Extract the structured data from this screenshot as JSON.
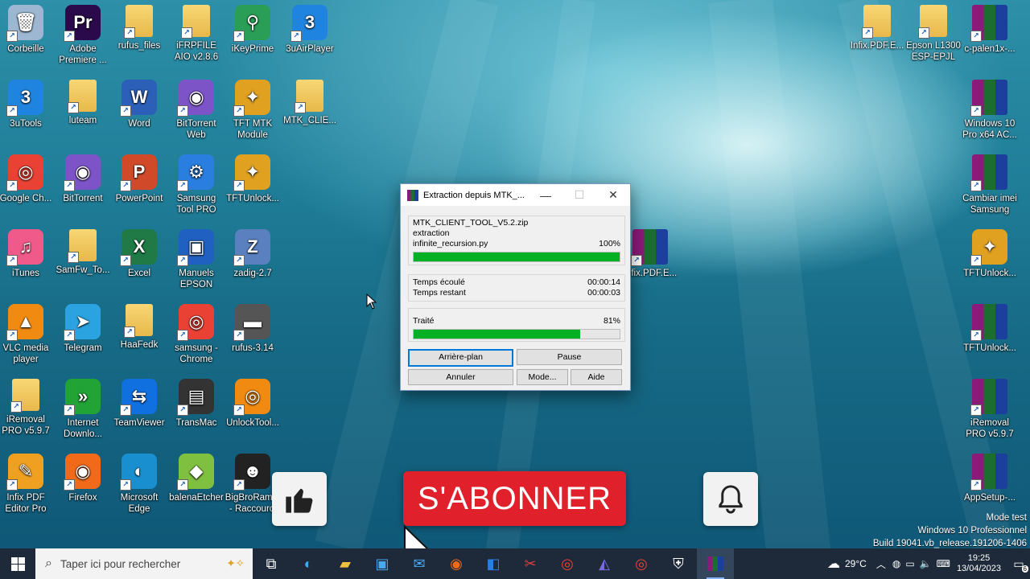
{
  "desktop": {
    "icons": [
      {
        "label": "Corbeille",
        "glyph": "🗑",
        "bg": "#9db7d2"
      },
      {
        "label": "Adobe Premiere ...",
        "glyph": "Pr",
        "bg": "#2a0a4a"
      },
      {
        "label": "rufus_files",
        "glyph": "",
        "bg": "folder"
      },
      {
        "label": "iFRPFILE AIO v2.8.6",
        "glyph": "",
        "bg": "folder"
      },
      {
        "label": "iKeyPrime",
        "glyph": "⚲",
        "bg": "#2a9d57"
      },
      {
        "label": "3uAirPlayer",
        "glyph": "3",
        "bg": "#1f84e0"
      },
      {
        "label": "3uTools",
        "glyph": "3",
        "bg": "#1f84e0"
      },
      {
        "label": "luteam",
        "glyph": "",
        "bg": "folder"
      },
      {
        "label": "Word",
        "glyph": "W",
        "bg": "#2b5fb8"
      },
      {
        "label": "BitTorrent Web",
        "glyph": "◉",
        "bg": "#7c54c8"
      },
      {
        "label": "TFT MTK Module",
        "glyph": "✦",
        "bg": "#e0a020"
      },
      {
        "label": "MTK_CLIE...",
        "glyph": "",
        "bg": "folder"
      },
      {
        "label": "Google Ch...",
        "glyph": "◎",
        "bg": "#e94235"
      },
      {
        "label": "BitTorrent",
        "glyph": "◉",
        "bg": "#7c54c8"
      },
      {
        "label": "PowerPoint",
        "glyph": "P",
        "bg": "#d04a2a"
      },
      {
        "label": "Samsung Tool PRO",
        "glyph": "⚙",
        "bg": "#2a7ee0"
      },
      {
        "label": "TFTUnlock...",
        "glyph": "✦",
        "bg": "#e0a020"
      },
      {
        "label": "iTunes",
        "glyph": "♫",
        "bg": "#f05a8a"
      },
      {
        "label": "SamFw_To...",
        "glyph": "",
        "bg": "folder"
      },
      {
        "label": "Excel",
        "glyph": "X",
        "bg": "#1f7a45"
      },
      {
        "label": "Manuels EPSON",
        "glyph": "▣",
        "bg": "#2060c0"
      },
      {
        "label": "zadig-2.7",
        "glyph": "Z",
        "bg": "#5a80c0"
      },
      {
        "label": "VLC media player",
        "glyph": "▲",
        "bg": "#f08a10"
      },
      {
        "label": "Telegram",
        "glyph": "➤",
        "bg": "#2aa3e0"
      },
      {
        "label": "HaaFedk",
        "glyph": "",
        "bg": "folder"
      },
      {
        "label": "samsung - Chrome",
        "glyph": "◎",
        "bg": "#e94235"
      },
      {
        "label": "rufus-3.14",
        "glyph": "▬",
        "bg": "#555"
      },
      {
        "label": "iRemoval PRO v5.9.7",
        "glyph": "",
        "bg": "folder"
      },
      {
        "label": "Internet Downlo...",
        "glyph": "»",
        "bg": "#21a336"
      },
      {
        "label": "TeamViewer",
        "glyph": "⇆",
        "bg": "#1070e0"
      },
      {
        "label": "TransMac",
        "glyph": "▤",
        "bg": "#333"
      },
      {
        "label": "UnlockTool...",
        "glyph": "◎",
        "bg": "#f08a10"
      },
      {
        "label": "Infix PDF Editor Pro",
        "glyph": "✎",
        "bg": "#f0a020"
      },
      {
        "label": "Firefox",
        "glyph": "◉",
        "bg": "#f06a1a"
      },
      {
        "label": "Microsoft Edge",
        "glyph": "◐",
        "bg": "#1a8fd0"
      },
      {
        "label": "balenaEtcher",
        "glyph": "◆",
        "bg": "#80c040"
      },
      {
        "label": "BigBroRam... - Raccourci",
        "glyph": "☻",
        "bg": "#222"
      },
      {
        "label": "Infix.PDF.E...",
        "glyph": "",
        "bg": "folder"
      },
      {
        "label": "Epson L1300 ESP-EPJL",
        "glyph": "",
        "bg": "folder"
      },
      {
        "label": "c-palen1x-...",
        "glyph": "",
        "bg": "rar"
      },
      {
        "label": "Windows 10 Pro x64 AC...",
        "glyph": "",
        "bg": "rar"
      },
      {
        "label": "Cambiar imei Samsung",
        "glyph": "",
        "bg": "rar"
      },
      {
        "label": "TFTUnlock...",
        "glyph": "✦",
        "bg": "#e0a020"
      },
      {
        "label": "TFTUnlock...",
        "glyph": "",
        "bg": "rar"
      },
      {
        "label": "iRemoval PRO v5.9.7",
        "glyph": "",
        "bg": "rar"
      },
      {
        "label": "AppSetup-...",
        "glyph": "",
        "bg": "rar"
      },
      {
        "label": "Infix.PDF.E...",
        "glyph": "",
        "bg": "rar"
      },
      {
        "label": "MTK_CLIE...",
        "glyph": "",
        "bg": "rar"
      }
    ]
  },
  "dialog": {
    "title": "Extraction depuis MTK_...",
    "archive": "MTK_CLIENT_TOOL_V5.2.zip",
    "action": "extraction",
    "file": "infinite_recursion.py",
    "file_percent_label": "100%",
    "file_progress": 1.0,
    "elapsed_label": "Temps écoulé",
    "elapsed_value": "00:00:14",
    "remaining_label": "Temps restant",
    "remaining_value": "00:00:03",
    "processed_label": "Traité",
    "processed_percent_label": "81%",
    "processed_progress": 0.81,
    "buttons": {
      "background": "Arrière-plan",
      "pause": "Pause",
      "cancel": "Annuler",
      "mode": "Mode...",
      "help": "Aide"
    }
  },
  "overlay": {
    "subscribe_label": "S'ABONNER"
  },
  "watermark": {
    "line1": "Mode test",
    "line2": "Windows 10 Professionnel",
    "line3": "Build 19041.vb_release.191206-1406"
  },
  "taskbar": {
    "search_placeholder": "Taper ici pour rechercher",
    "weather": "29°C",
    "time": "19:25",
    "date": "13/04/2023",
    "notification_count": "6"
  },
  "colors": {
    "progress_green": "#06b025",
    "subscribe_red": "#e0202a",
    "taskbar_bg": "#1e2a3a"
  }
}
